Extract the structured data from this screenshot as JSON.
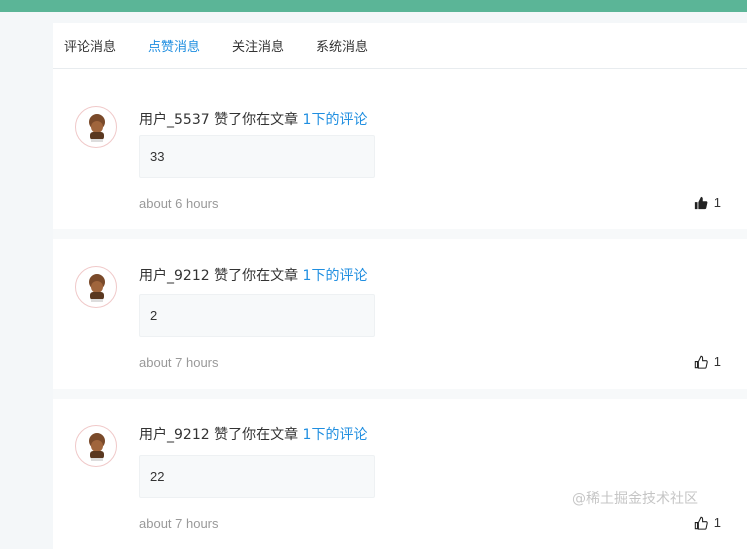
{
  "tabs": [
    {
      "label": "评论消息",
      "active": false
    },
    {
      "label": "点赞消息",
      "active": true
    },
    {
      "label": "关注消息",
      "active": false
    },
    {
      "label": "系统消息",
      "active": false
    }
  ],
  "notifications": [
    {
      "user": "用户_5537",
      "action": " 赞了你在文章 ",
      "link_text": "1下的评论",
      "comment": "33",
      "time": "about 6 hours",
      "likes": "1",
      "liked": true
    },
    {
      "user": "用户_9212",
      "action": " 赞了你在文章 ",
      "link_text": "1下的评论",
      "comment": "2",
      "time": "about 7 hours",
      "likes": "1",
      "liked": false
    },
    {
      "user": "用户_9212",
      "action": " 赞了你在文章 ",
      "link_text": "1下的评论",
      "comment": "22",
      "time": "about 7 hours",
      "likes": "1",
      "liked": false
    }
  ],
  "watermark": "@稀土掘金技术社区",
  "colors": {
    "accent": "#1f8ee0",
    "top_bar": "#5bb597"
  }
}
